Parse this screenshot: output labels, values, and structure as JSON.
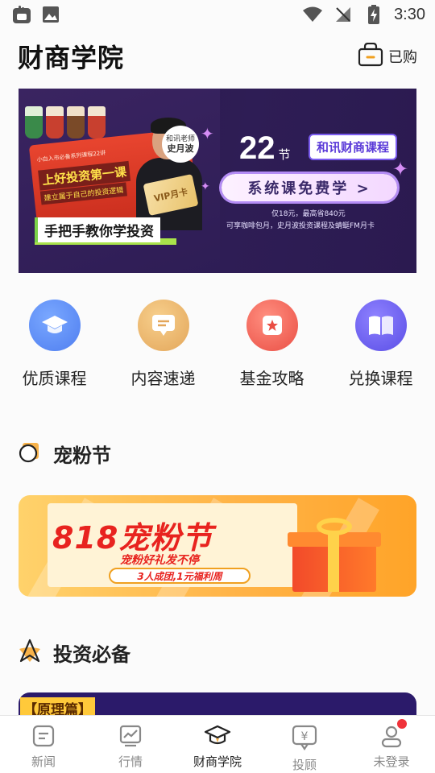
{
  "status_bar": {
    "time": "3:30"
  },
  "header": {
    "title": "财商学院",
    "purchased_label": "已购"
  },
  "banner": {
    "card_small_text": "小白入市必备系列课程22讲",
    "card_title": "上好投资第一课",
    "card_subtitle": "建立属于自己的投资逻辑",
    "teacher_role": "和讯老师",
    "teacher_name": "史月波",
    "vip_label": "VIP月卡",
    "slogan": "手把手教你学投资",
    "lesson_count": "22",
    "lesson_unit": "节",
    "course_tag": "和讯财商课程",
    "free_cta": "系统课免费学 >",
    "price_line": "仅18元，最高省840元",
    "benefit_line": "可享咖啡包月，史月波投资课程及蜻蜓FM月卡"
  },
  "quick_entries": [
    {
      "label": "优质课程",
      "icon": "graduation-cap-icon",
      "color": "#4f83f0"
    },
    {
      "label": "内容速递",
      "icon": "message-card-icon",
      "color": "#e6a85a"
    },
    {
      "label": "基金攻略",
      "icon": "star-card-icon",
      "color": "#ef5a4a"
    },
    {
      "label": "兑换课程",
      "icon": "open-book-icon",
      "color": "#6a5cf0"
    }
  ],
  "section_fans": {
    "title": "宠粉节"
  },
  "promo": {
    "title": "818宠粉节",
    "subtitle": "宠粉好礼发不停",
    "tag": "3人成团,1元福利周"
  },
  "section_invest": {
    "title": "投资必备"
  },
  "peek_card": {
    "tag": "【原理篇】"
  },
  "tabbar": [
    {
      "label": "新闻",
      "icon": "news-icon",
      "active": false
    },
    {
      "label": "行情",
      "icon": "chart-icon",
      "active": false
    },
    {
      "label": "财商学院",
      "icon": "academy-cap-icon",
      "active": true
    },
    {
      "label": "投顾",
      "icon": "advisor-yen-icon",
      "active": false
    },
    {
      "label": "未登录",
      "icon": "user-icon",
      "active": false
    }
  ]
}
